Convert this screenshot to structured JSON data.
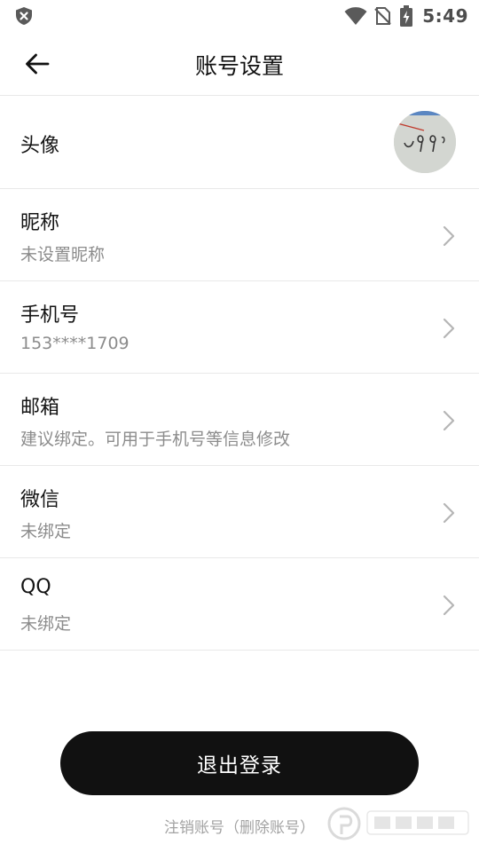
{
  "status_bar": {
    "time": "5:49",
    "icons": [
      "shield-x-icon",
      "wifi-icon",
      "no-sim-icon",
      "battery-charging-icon"
    ]
  },
  "header": {
    "title": "账号设置",
    "back_icon": "arrow-left-icon"
  },
  "rows": {
    "avatar": {
      "label": "头像",
      "avatar_image": "handwritten-avatar"
    },
    "nickname": {
      "label": "昵称",
      "value": "未设置昵称"
    },
    "phone": {
      "label": "手机号",
      "value": "153****1709"
    },
    "email": {
      "label": "邮箱",
      "value": "建议绑定。可用于手机号等信息修改"
    },
    "wechat": {
      "label": "微信",
      "value": "未绑定"
    },
    "qq": {
      "label": "QQ",
      "value": "未绑定"
    }
  },
  "actions": {
    "logout_label": "退出登录",
    "delete_account_label": "注销账号（删除账号）"
  },
  "colors": {
    "primary_button": "#111111",
    "subtitle_text": "#8c8c8c",
    "divider": "#e9e9e9"
  }
}
